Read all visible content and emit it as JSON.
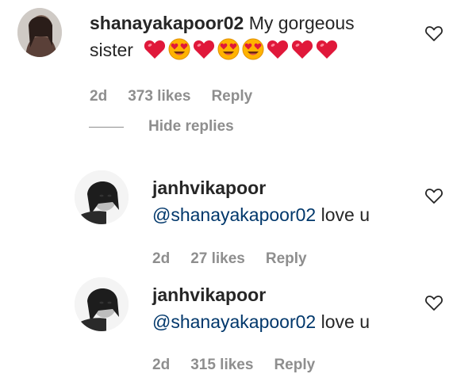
{
  "comment": {
    "username": "shanayakapoor02",
    "text_line1": "My gorgeous",
    "text_line2": "sister",
    "emojis": [
      "red-heart",
      "heart-eyes",
      "red-heart",
      "heart-eyes",
      "heart-eyes",
      "red-heart",
      "red-heart",
      "red-heart"
    ],
    "time": "2d",
    "likes": "373 likes",
    "reply_label": "Reply",
    "hide_replies_label": "Hide replies"
  },
  "replies": [
    {
      "username": "janhvikapoor",
      "mention": "@shanayakapoor02",
      "text": "love u",
      "time": "2d",
      "likes": "27 likes",
      "reply_label": "Reply"
    },
    {
      "username": "janhvikapoor",
      "mention": "@shanayakapoor02",
      "text": "love u",
      "time": "2d",
      "likes": "315 likes",
      "reply_label": "Reply"
    }
  ],
  "colors": {
    "heart_emoji": "#e0183a",
    "heart_eyes_face": "#ffb300",
    "meta_text": "#8e8e8e",
    "mention": "#00376b"
  },
  "icons": [
    "like-heart-outline-icon",
    "red-heart-emoji",
    "heart-eyes-emoji"
  ]
}
